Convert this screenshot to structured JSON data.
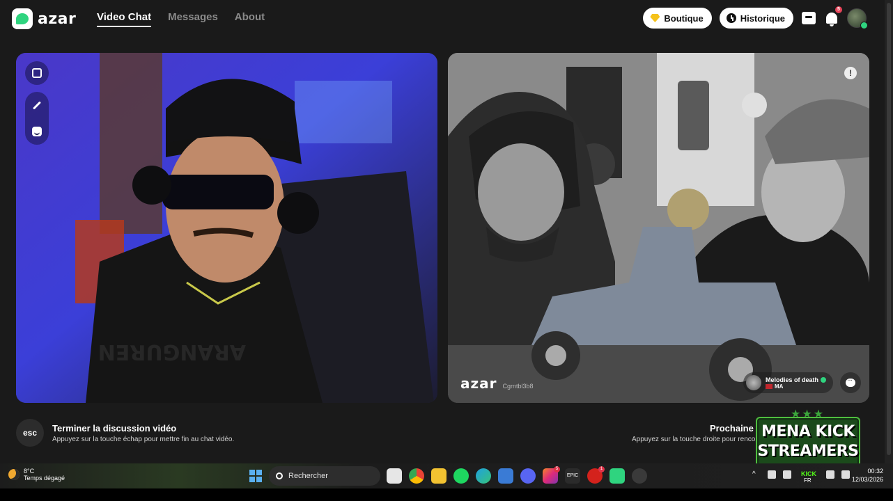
{
  "brand": {
    "name": "azar"
  },
  "nav": {
    "links": [
      {
        "label": "Video Chat",
        "active": true
      },
      {
        "label": "Messages",
        "active": false
      },
      {
        "label": "About",
        "active": false
      }
    ],
    "boutique_label": "Boutique",
    "historique_label": "Historique",
    "notification_count": "5"
  },
  "partner": {
    "watermark": "azar",
    "session_id": "Cgrntbl3b8",
    "name": "Melodies of death",
    "country": "MA"
  },
  "actions": {
    "esc_key": "esc",
    "end_title": "Terminer la discussion vidéo",
    "end_hint": "Appuyez sur la touche échap pour mettre fin au chat vidéo.",
    "next_title": "Prochaine",
    "next_hint": "Appuyez sur la touche droite pour renco"
  },
  "overlay": {
    "line1": "MENA KICK",
    "line2": "STREAMERS"
  },
  "taskbar": {
    "temperature": "8°C",
    "weather": "Temps dégagé",
    "search_placeholder": "Rechercher",
    "kick": "KICK",
    "lang": "FR",
    "time": "00:32",
    "date": "12/03/2026",
    "badges": {
      "instagram": "5",
      "fire": "1"
    }
  },
  "colors": {
    "accent": "#2fd47f",
    "background": "#1a1a1a",
    "badge_green": "#1b4a1b"
  }
}
